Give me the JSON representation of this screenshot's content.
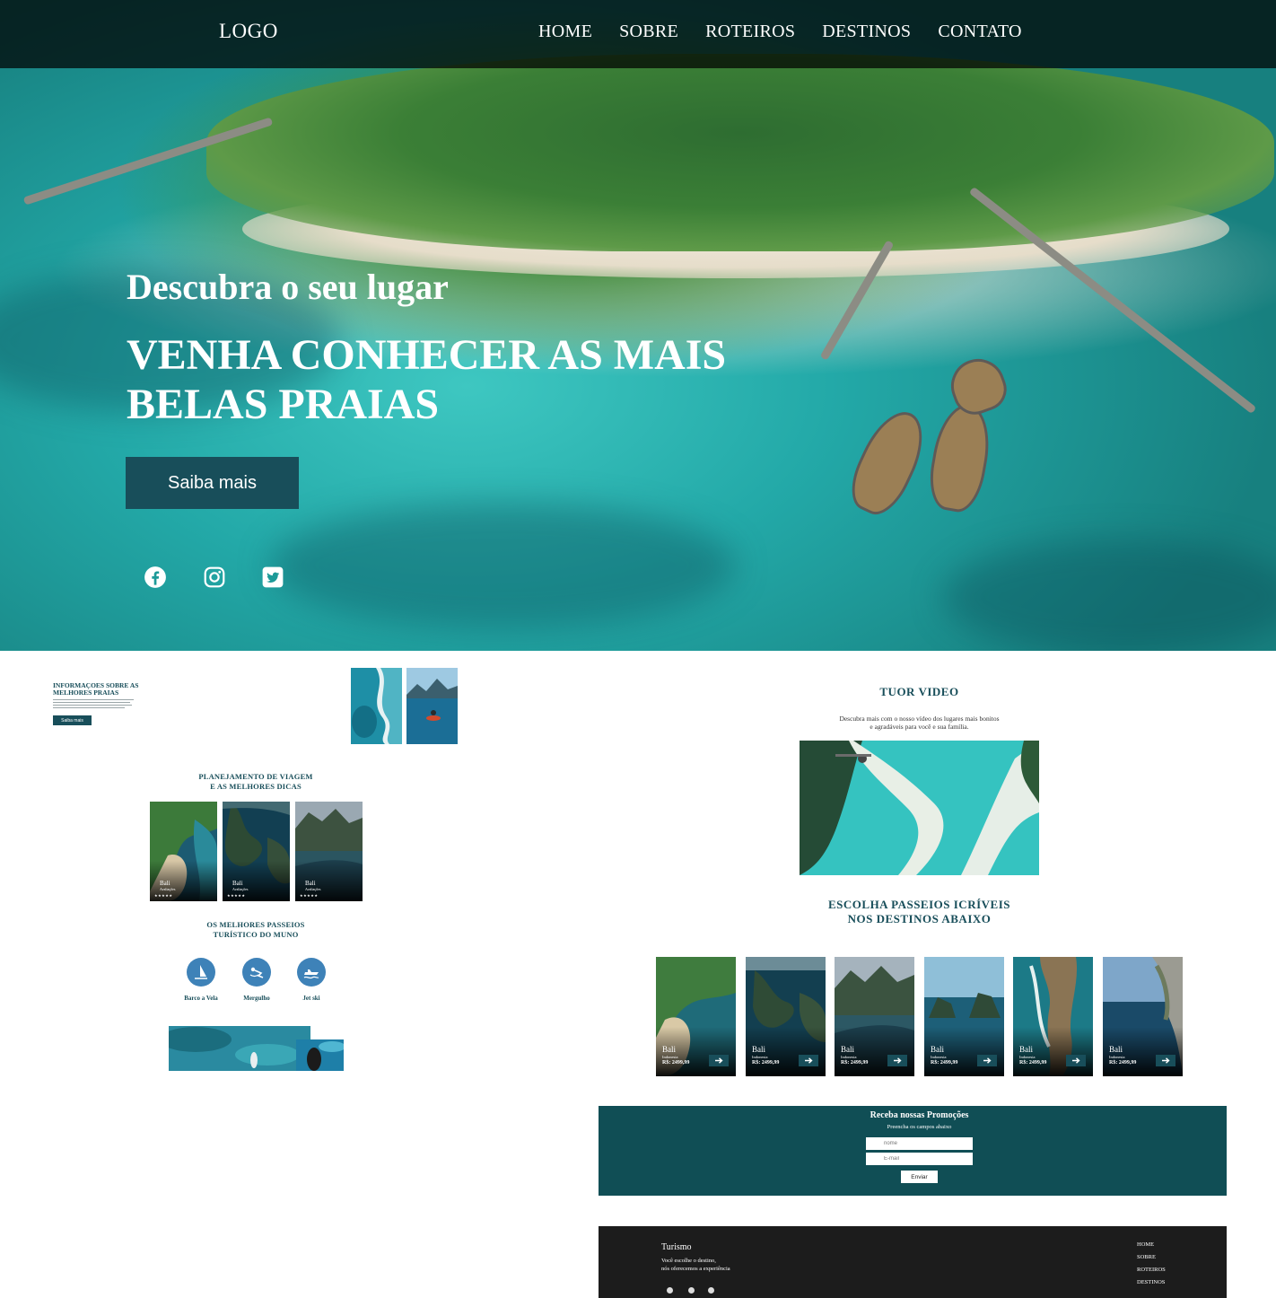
{
  "header": {
    "logo": "LOGO",
    "nav": [
      "HOME",
      "SOBRE",
      "ROTEIROS",
      "DESTINOS",
      "CONTATO"
    ]
  },
  "hero": {
    "subtitle": "Descubra o seu lugar",
    "title": "VENHA CONHECER AS MAIS BELAS PRAIAS",
    "button": "Saiba mais",
    "social_icons": [
      "facebook-icon",
      "instagram-icon",
      "twitter-icon"
    ]
  },
  "info": {
    "title": "INFORMAÇOES SOBRE AS MELHORES PRAIAS",
    "button": "Saiba mais"
  },
  "planning": {
    "title_line1": "PLANEJAMENTO DE VIAGEM",
    "title_line2": "E AS MELHORES DICAS",
    "cards": [
      {
        "name": "Bali",
        "reviews": "Avaliações",
        "stars": "★★★★★"
      },
      {
        "name": "Bali",
        "reviews": "Avaliações",
        "stars": "★★★★★"
      },
      {
        "name": "Bali",
        "reviews": "Avaliações",
        "stars": "★★★★★"
      }
    ]
  },
  "tours": {
    "title_line1": "OS MELHORES PASSEIOS",
    "title_line2": "TURÍSTICO DO MUNO",
    "items": [
      {
        "label": "Barco a Vela",
        "icon": "windsurf-icon"
      },
      {
        "label": "Mergulho",
        "icon": "diving-icon"
      },
      {
        "label": "Jet ski",
        "icon": "jetski-icon"
      }
    ]
  },
  "video": {
    "title": "TUOR VIDEO",
    "text": "Descubra mais com o nosso vídeo dos lugares mais bonitos e agradáveis para você e sua família."
  },
  "destinations": {
    "title_line1": "ESCOLHA PASSEIOS ICRÍVEIS",
    "title_line2": "NOS DESTINOS ABAIXO",
    "cards": [
      {
        "name": "Bali",
        "country": "Indonesia",
        "price": "R$: 2499,99"
      },
      {
        "name": "Bali",
        "country": "Indonesia",
        "price": "R$: 2499,99"
      },
      {
        "name": "Bali",
        "country": "Indonesia",
        "price": "R$: 2499,99"
      },
      {
        "name": "Bali",
        "country": "Indonesia",
        "price": "R$: 2499,99"
      },
      {
        "name": "Bali",
        "country": "Indonesia",
        "price": "R$: 2499,99"
      },
      {
        "name": "Bali",
        "country": "Indonesia",
        "price": "R$: 2499,99"
      }
    ]
  },
  "promo": {
    "title": "Receba nossas Promoções",
    "subtitle": "Preencha os campos abaixo",
    "name_placeholder": "nome",
    "email_placeholder": "E-mail",
    "button": "Enviar"
  },
  "footer": {
    "brand": "Turismo",
    "text_line1": "Você escolhe o destino,",
    "text_line2": "nós oferecemos a experiência",
    "links": [
      "HOME",
      "SOBRE",
      "ROTEIROS",
      "DESTINOS"
    ]
  },
  "colors": {
    "accent": "#184e5a",
    "promo_bg": "#104e55",
    "footer_bg": "#1c1c1c",
    "tour_icon": "#3e82b8"
  }
}
